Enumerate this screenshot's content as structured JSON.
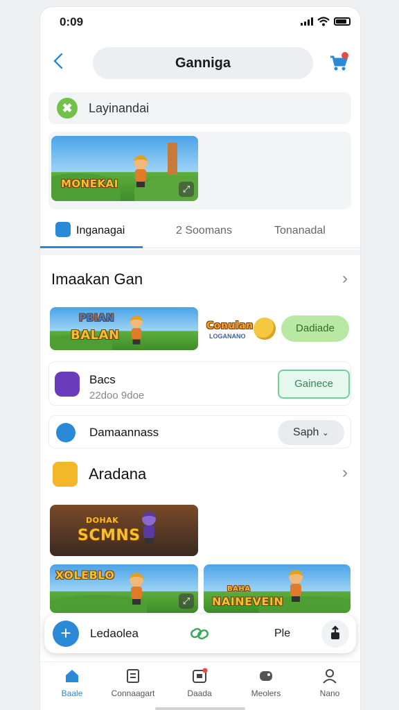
{
  "status": {
    "time": "0:09"
  },
  "header": {
    "title": "Ganniga"
  },
  "search": {
    "placeholder": "Layinandai"
  },
  "banner": {
    "game_title": "MONEKAI"
  },
  "tabs": [
    {
      "label": "Inganagai"
    },
    {
      "label": "2 Soomans"
    },
    {
      "label": "Tonanadal"
    }
  ],
  "section1": {
    "title": "Imaakan Gan",
    "promo": {
      "game_title_line1": "PBIAN",
      "game_title_line2": "BALAN",
      "logo_text_1": "Conulan",
      "logo_text_2": "LOGANANO",
      "button": "Dadiade"
    },
    "item1": {
      "title": "Bacs",
      "subtitle": "22doo 9doe",
      "button": "Gainece"
    },
    "item2": {
      "title": "Damaannass",
      "button": "Saph"
    }
  },
  "section2": {
    "title": "Aradana",
    "cards": [
      {
        "title_small": "DOHAK",
        "title": "SCMNS"
      },
      {
        "title": "XOLEBLO"
      },
      {
        "title_small": "BAHA",
        "title": "NAINEVEIN"
      }
    ]
  },
  "floatbar": {
    "label": "Ledaolea",
    "file_label": "Ple"
  },
  "nav": [
    {
      "label": "Baale"
    },
    {
      "label": "Connaagart"
    },
    {
      "label": "Daada"
    },
    {
      "label": "Meolers"
    },
    {
      "label": "Nano"
    }
  ]
}
